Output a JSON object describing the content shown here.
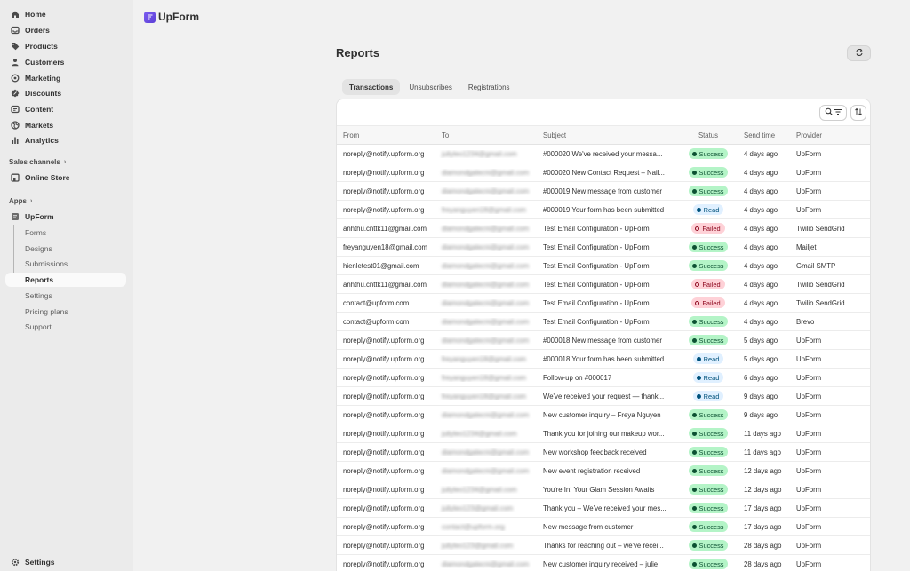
{
  "sidebar": {
    "nav": [
      {
        "label": "Home",
        "icon": "home-icon"
      },
      {
        "label": "Orders",
        "icon": "inbox-icon"
      },
      {
        "label": "Products",
        "icon": "tag-icon"
      },
      {
        "label": "Customers",
        "icon": "person-icon"
      },
      {
        "label": "Marketing",
        "icon": "target-icon"
      },
      {
        "label": "Discounts",
        "icon": "discount-icon"
      },
      {
        "label": "Content",
        "icon": "content-icon"
      },
      {
        "label": "Markets",
        "icon": "globe-icon"
      },
      {
        "label": "Analytics",
        "icon": "bar-chart-icon"
      }
    ],
    "sales_channels_label": "Sales channels",
    "online_store_label": "Online Store",
    "apps_label": "Apps",
    "app_name": "UpForm",
    "app_sub": [
      "Forms",
      "Designs",
      "Submissions",
      "Reports",
      "Settings",
      "Pricing plans",
      "Support"
    ],
    "active_sub": "Reports",
    "settings_label": "Settings"
  },
  "header": {
    "app_name": "UpForm"
  },
  "page": {
    "title": "Reports"
  },
  "tabs": [
    "Transactions",
    "Unsubscribes",
    "Registrations"
  ],
  "active_tab": "Transactions",
  "table": {
    "columns": [
      "From",
      "To",
      "Subject",
      "Status",
      "Send time",
      "Provider"
    ],
    "rows": [
      {
        "from": "noreply@notify.upform.org",
        "to": "juliyleo1234@gmail.com",
        "subject": "#000020 We've received your messa...",
        "status": "Success",
        "time": "4 days ago",
        "provider": "UpForm"
      },
      {
        "from": "noreply@notify.upform.org",
        "to": "diamondgalecni@gmail.com",
        "subject": "#000020 New Contact Request – Nail...",
        "status": "Success",
        "time": "4 days ago",
        "provider": "UpForm"
      },
      {
        "from": "noreply@notify.upform.org",
        "to": "diamondgalecni@gmail.com",
        "subject": "#000019 New message from customer",
        "status": "Success",
        "time": "4 days ago",
        "provider": "UpForm"
      },
      {
        "from": "noreply@notify.upform.org",
        "to": "freyanguyen18@gmail.com",
        "subject": "#000019 Your form has been submitted",
        "status": "Read",
        "time": "4 days ago",
        "provider": "UpForm"
      },
      {
        "from": "anhthu.cnttk11@gmail.com",
        "to": "diamondgalecni@gmail.com",
        "subject": "Test Email Configuration - UpForm",
        "status": "Failed",
        "time": "4 days ago",
        "provider": "Twilio SendGrid"
      },
      {
        "from": "freyanguyen18@gmail.com",
        "to": "diamondgalecni@gmail.com",
        "subject": "Test Email Configuration - UpForm",
        "status": "Success",
        "time": "4 days ago",
        "provider": "Mailjet"
      },
      {
        "from": "hienletest01@gmail.com",
        "to": "diamondgalecni@gmail.com",
        "subject": "Test Email Configuration - UpForm",
        "status": "Success",
        "time": "4 days ago",
        "provider": "Gmail SMTP"
      },
      {
        "from": "anhthu.cnttk11@gmail.com",
        "to": "diamondgalecni@gmail.com",
        "subject": "Test Email Configuration - UpForm",
        "status": "Failed",
        "time": "4 days ago",
        "provider": "Twilio SendGrid"
      },
      {
        "from": "contact@upform.com",
        "to": "diamondgalecni@gmail.com",
        "subject": "Test Email Configuration - UpForm",
        "status": "Failed",
        "time": "4 days ago",
        "provider": "Twilio SendGrid"
      },
      {
        "from": "contact@upform.com",
        "to": "diamondgalecni@gmail.com",
        "subject": "Test Email Configuration - UpForm",
        "status": "Success",
        "time": "4 days ago",
        "provider": "Brevo"
      },
      {
        "from": "noreply@notify.upform.org",
        "to": "diamondgalecni@gmail.com",
        "subject": "#000018 New message from customer",
        "status": "Success",
        "time": "5 days ago",
        "provider": "UpForm"
      },
      {
        "from": "noreply@notify.upform.org",
        "to": "freyanguyen18@gmail.com",
        "subject": "#000018 Your form has been submitted",
        "status": "Read",
        "time": "5 days ago",
        "provider": "UpForm"
      },
      {
        "from": "noreply@notify.upform.org",
        "to": "freyanguyen18@gmail.com",
        "subject": "Follow-up on #000017",
        "status": "Read",
        "time": "6 days ago",
        "provider": "UpForm"
      },
      {
        "from": "noreply@notify.upform.org",
        "to": "freyanguyen18@gmail.com",
        "subject": "We've received your request — thank...",
        "status": "Read",
        "time": "9 days ago",
        "provider": "UpForm"
      },
      {
        "from": "noreply@notify.upform.org",
        "to": "diamondgalecni@gmail.com",
        "subject": "New customer inquiry – Freya Nguyen",
        "status": "Success",
        "time": "9 days ago",
        "provider": "UpForm"
      },
      {
        "from": "noreply@notify.upform.org",
        "to": "juliyleo1234@gmail.com",
        "subject": "Thank you for joining our makeup wor...",
        "status": "Success",
        "time": "11 days ago",
        "provider": "UpForm"
      },
      {
        "from": "noreply@notify.upform.org",
        "to": "diamondgalecni@gmail.com",
        "subject": "New workshop feedback received",
        "status": "Success",
        "time": "11 days ago",
        "provider": "UpForm"
      },
      {
        "from": "noreply@notify.upform.org",
        "to": "diamondgalecni@gmail.com",
        "subject": "New event registration received",
        "status": "Success",
        "time": "12 days ago",
        "provider": "UpForm"
      },
      {
        "from": "noreply@notify.upform.org",
        "to": "juliyleo1234@gmail.com",
        "subject": "You're In! Your Glam Session Awaits",
        "status": "Success",
        "time": "12 days ago",
        "provider": "UpForm"
      },
      {
        "from": "noreply@notify.upform.org",
        "to": "juliyleo123@gmail.com",
        "subject": "Thank you – We've received your mes...",
        "status": "Success",
        "time": "17 days ago",
        "provider": "UpForm"
      },
      {
        "from": "noreply@notify.upform.org",
        "to": "contact@upform.org",
        "subject": "New message from customer",
        "status": "Success",
        "time": "17 days ago",
        "provider": "UpForm"
      },
      {
        "from": "noreply@notify.upform.org",
        "to": "juliyleo123@gmail.com",
        "subject": "Thanks for reaching out – we've recei...",
        "status": "Success",
        "time": "28 days ago",
        "provider": "UpForm"
      },
      {
        "from": "noreply@notify.upform.org",
        "to": "diamondgalecni@gmail.com",
        "subject": "New customer inquiry received – julie",
        "status": "Success",
        "time": "28 days ago",
        "provider": "UpForm"
      }
    ]
  }
}
